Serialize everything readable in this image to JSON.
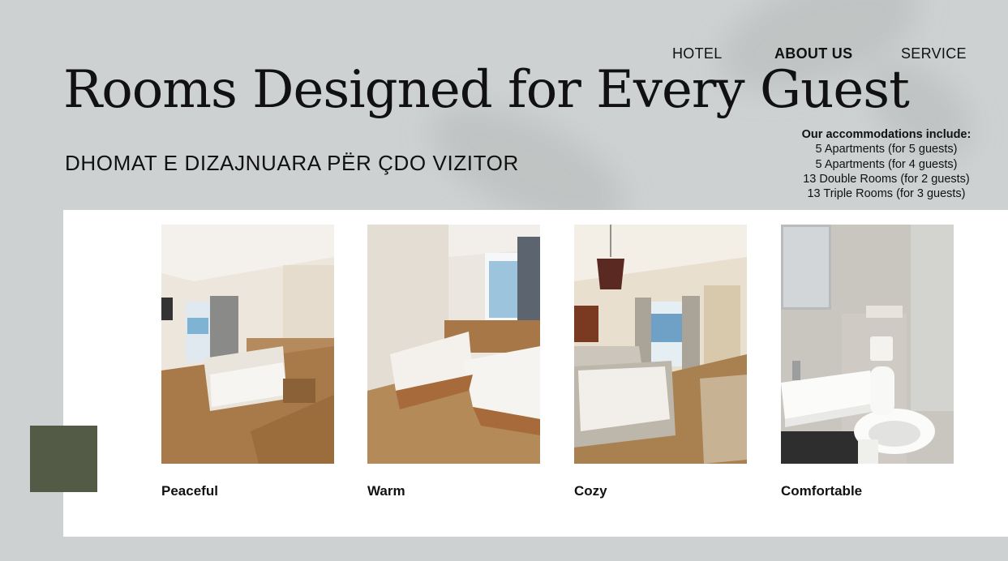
{
  "nav": {
    "items": [
      {
        "label": "HOTEL",
        "active": false
      },
      {
        "label": "ABOUT US",
        "active": true
      },
      {
        "label": "SERVICE",
        "active": false
      }
    ]
  },
  "hero": {
    "title": "Rooms Designed for Every Guest",
    "subtitle": "DHOMAT E DIZAJNUARA PËR ÇDO VIZITOR"
  },
  "accommodations": {
    "heading": "Our accommodations include:",
    "lines": [
      "5 Apartments (for 5 guests)",
      "5 Apartments (for 4 guests)",
      "13 Double Rooms (for 2 guests)",
      "13 Triple Rooms (for 3 guests)"
    ]
  },
  "rooms": [
    {
      "label": "Peaceful"
    },
    {
      "label": "Warm"
    },
    {
      "label": "Cozy"
    },
    {
      "label": "Comfortable"
    }
  ],
  "colors": {
    "background": "#cdd1d2",
    "panel": "#ffffff",
    "accent": "#535a45"
  }
}
